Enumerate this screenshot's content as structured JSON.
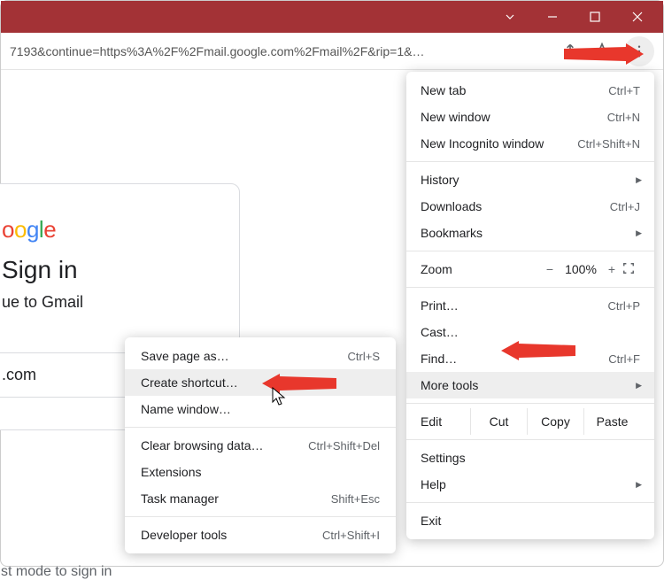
{
  "window": {
    "titlebar_color": "#a33236"
  },
  "addressbar": {
    "url_fragment": "7193&continue=https%3A%2F%2Fmail.google.com%2Fmail%2F&rip=1&…"
  },
  "page": {
    "logo_text": "Google",
    "heading": "Sign in",
    "subtitle_fragment": "ue to Gmail",
    "email_fragment": ".com",
    "footer_fragment": "st mode to sign in"
  },
  "menu": {
    "new_tab": {
      "label": "New tab",
      "shortcut": "Ctrl+T"
    },
    "new_window": {
      "label": "New window",
      "shortcut": "Ctrl+N"
    },
    "incognito": {
      "label": "New Incognito window",
      "shortcut": "Ctrl+Shift+N"
    },
    "history": {
      "label": "History"
    },
    "downloads": {
      "label": "Downloads",
      "shortcut": "Ctrl+J"
    },
    "bookmarks": {
      "label": "Bookmarks"
    },
    "zoom": {
      "label": "Zoom",
      "minus": "−",
      "value": "100%",
      "plus": "+"
    },
    "print": {
      "label": "Print…",
      "shortcut": "Ctrl+P"
    },
    "cast": {
      "label": "Cast…"
    },
    "find": {
      "label": "Find…",
      "shortcut": "Ctrl+F"
    },
    "more_tools": {
      "label": "More tools"
    },
    "edit": {
      "label": "Edit",
      "cut": "Cut",
      "copy": "Copy",
      "paste": "Paste"
    },
    "settings": {
      "label": "Settings"
    },
    "help": {
      "label": "Help"
    },
    "exit": {
      "label": "Exit"
    }
  },
  "submenu": {
    "save_page": {
      "label": "Save page as…",
      "shortcut": "Ctrl+S"
    },
    "create_shortcut": {
      "label": "Create shortcut…"
    },
    "name_window": {
      "label": "Name window…"
    },
    "clear_data": {
      "label": "Clear browsing data…",
      "shortcut": "Ctrl+Shift+Del"
    },
    "extensions": {
      "label": "Extensions"
    },
    "task_manager": {
      "label": "Task manager",
      "shortcut": "Shift+Esc"
    },
    "dev_tools": {
      "label": "Developer tools",
      "shortcut": "Ctrl+Shift+I"
    }
  }
}
